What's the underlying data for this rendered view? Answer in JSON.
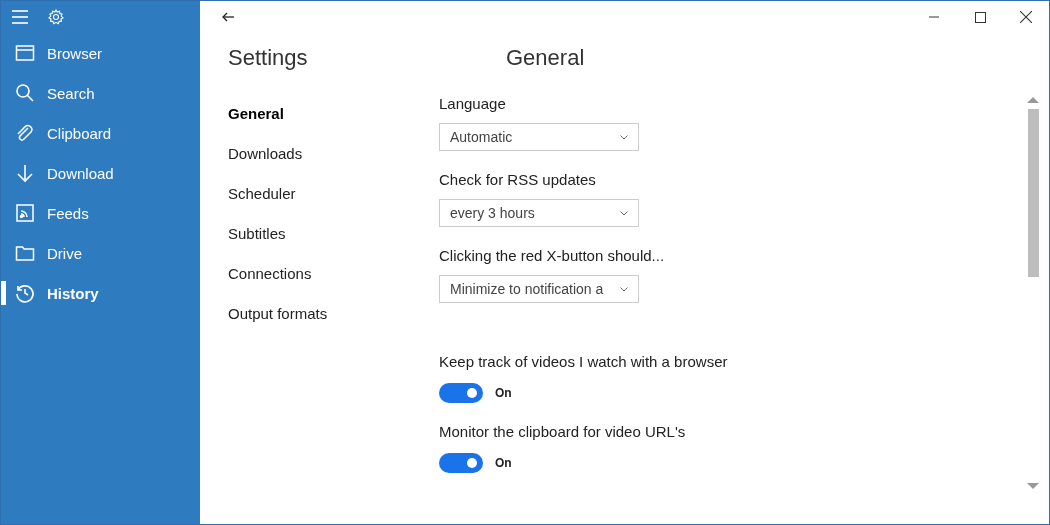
{
  "sidebar": {
    "items": [
      {
        "label": "Browser",
        "kind": "browser",
        "selected": false
      },
      {
        "label": "Search",
        "kind": "search",
        "selected": false
      },
      {
        "label": "Clipboard",
        "kind": "clip",
        "selected": false
      },
      {
        "label": "Download",
        "kind": "download",
        "selected": false
      },
      {
        "label": "Feeds",
        "kind": "feed",
        "selected": false
      },
      {
        "label": "Drive",
        "kind": "folder",
        "selected": false
      },
      {
        "label": "History",
        "kind": "history",
        "selected": true
      }
    ]
  },
  "page_title": "Settings",
  "section_title": "General",
  "nav": [
    {
      "label": "General",
      "selected": true
    },
    {
      "label": "Downloads",
      "selected": false
    },
    {
      "label": "Scheduler",
      "selected": false
    },
    {
      "label": "Subtitles",
      "selected": false
    },
    {
      "label": "Connections",
      "selected": false
    },
    {
      "label": "Output formats",
      "selected": false
    }
  ],
  "settings": [
    {
      "kind": "dropdown",
      "label": "Language",
      "value": "Automatic"
    },
    {
      "kind": "dropdown",
      "label": "Check for RSS updates",
      "value": "every 3 hours"
    },
    {
      "kind": "dropdown",
      "label": "Clicking the red X-button should...",
      "value": "Minimize to notification a"
    },
    {
      "kind": "toggle",
      "label": "Keep track of videos I watch with a browser",
      "on": true,
      "state_text": "On"
    },
    {
      "kind": "toggle",
      "label": "Monitor the clipboard for video URL's",
      "on": true,
      "state_text": "On"
    }
  ]
}
